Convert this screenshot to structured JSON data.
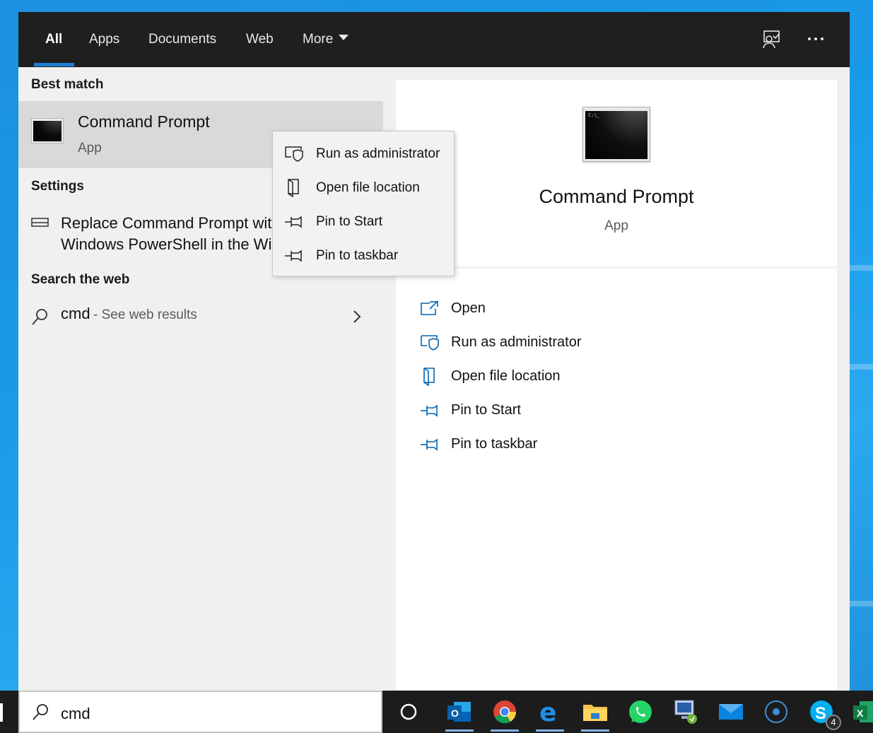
{
  "tabs": [
    {
      "label": "All",
      "active": true
    },
    {
      "label": "Apps"
    },
    {
      "label": "Documents"
    },
    {
      "label": "Web"
    },
    {
      "label": "More"
    }
  ],
  "top_icons": [
    "feedback-icon",
    "more-options-icon"
  ],
  "sections": {
    "best_match": "Best match",
    "settings": "Settings",
    "search_web": "Search the web"
  },
  "best_match_item": {
    "title": "Command Prompt",
    "type": "App"
  },
  "settings_item": {
    "line1": "Replace Command Prompt with",
    "line2": "Windows PowerShell in the Win"
  },
  "web_item": {
    "query": "cmd",
    "hint": "- See web results"
  },
  "context_menu": [
    {
      "label": "Run as administrator",
      "icon": "shield-icon"
    },
    {
      "label": "Open file location",
      "icon": "folder-location-icon"
    },
    {
      "label": "Pin to Start",
      "icon": "pin-icon"
    },
    {
      "label": "Pin to taskbar",
      "icon": "pin-icon"
    }
  ],
  "detail": {
    "title": "Command Prompt",
    "type": "App",
    "actions": [
      {
        "label": "Open",
        "icon": "open-icon"
      },
      {
        "label": "Run as administrator",
        "icon": "shield-icon"
      },
      {
        "label": "Open file location",
        "icon": "folder-location-icon"
      },
      {
        "label": "Pin to Start",
        "icon": "pin-icon"
      },
      {
        "label": "Pin to taskbar",
        "icon": "pin-icon"
      }
    ]
  },
  "taskbar": {
    "search_value": "cmd",
    "apps": [
      "cortana-icon",
      "outlook-icon",
      "chrome-icon",
      "edge-icon",
      "file-explorer-icon",
      "whatsapp-icon",
      "remote-desktop-icon",
      "mail-icon",
      "media-icon",
      "skype-icon",
      "excel-icon"
    ],
    "skype_badge": "4"
  },
  "colors": {
    "accent": "#1e7ed6",
    "topbar": "#1f1f1f",
    "taskbar": "#1c1c1c",
    "icon_blue": "#0063b1"
  }
}
